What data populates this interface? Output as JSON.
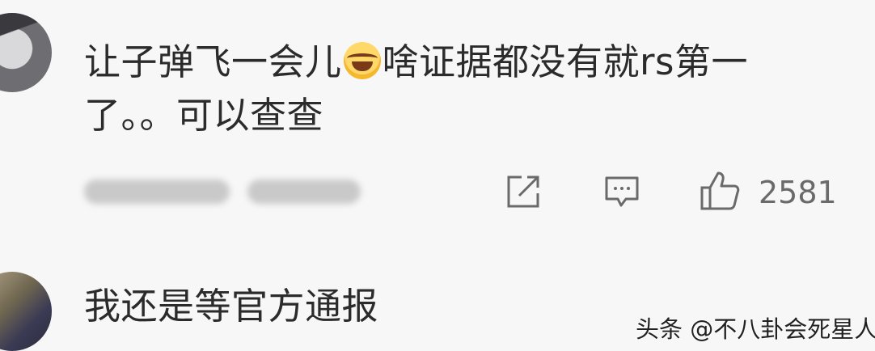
{
  "comments": [
    {
      "text_part1": "让子弹飞一会儿",
      "emoji": "laughing-crying-emoji",
      "text_part2": "啥证据都没有就rs第一",
      "text_line2": "了。。可以查查",
      "likes": "2581",
      "meta_blurred": true,
      "icons": {
        "share": "share-icon",
        "reply": "reply-icon",
        "like": "thumbs-up-icon"
      }
    },
    {
      "text": "我还是等官方通报"
    }
  ],
  "watermark": "头条 @不八卦会死星人",
  "colors": {
    "background": "#f7f7f7",
    "text": "#2b2b2b",
    "icon": "#6a6a6a"
  }
}
